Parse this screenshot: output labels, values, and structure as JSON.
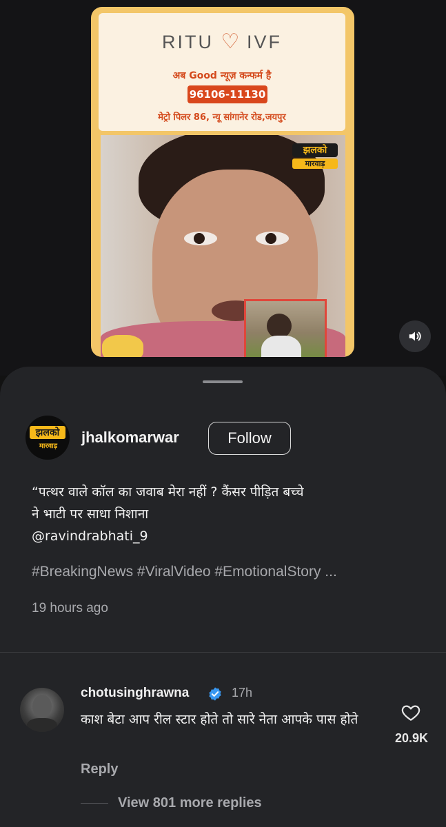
{
  "ad": {
    "brand_left": "RITU",
    "brand_right": "IVF",
    "tagline": "अब Good न्यूज़ कन्फर्म है",
    "phone": "96106-11130",
    "address": "मेट्रो पिलर 86, न्यू सांगानेर रोड,जयपुर"
  },
  "video_overlay_logo": {
    "line1": "झलको",
    "line2": "मारवाड़"
  },
  "post": {
    "author": "jhalkomarwar",
    "follow_label": "Follow",
    "caption_line1": "“पत्थर वाले कॉल का जवाब मेरा नहीं ? कैंसर पीड़ित बच्चे",
    "caption_line2": " ने भाटी पर साधा निशाना",
    "caption_mention": "@ravindrabhati_9",
    "hashtags": "#BreakingNews #ViralVideo #EmotionalStory ...",
    "time_ago": "19 hours ago"
  },
  "comment": {
    "username": "chotusinghrawna",
    "time": "17h",
    "text": "काश बेटा आप रील स्टार होते तो सारे नेता आपके पास होते",
    "likes": "20.9K",
    "reply_label": "Reply",
    "view_replies_label": "View 801 more replies"
  },
  "colors": {
    "background": "#121212",
    "sheet": "#232427",
    "verified": "#3897f0",
    "ad_accent": "#d9471c",
    "card_border": "#f3c668"
  },
  "icons": [
    "speaker-icon",
    "verified-badge-icon",
    "heart-icon"
  ]
}
